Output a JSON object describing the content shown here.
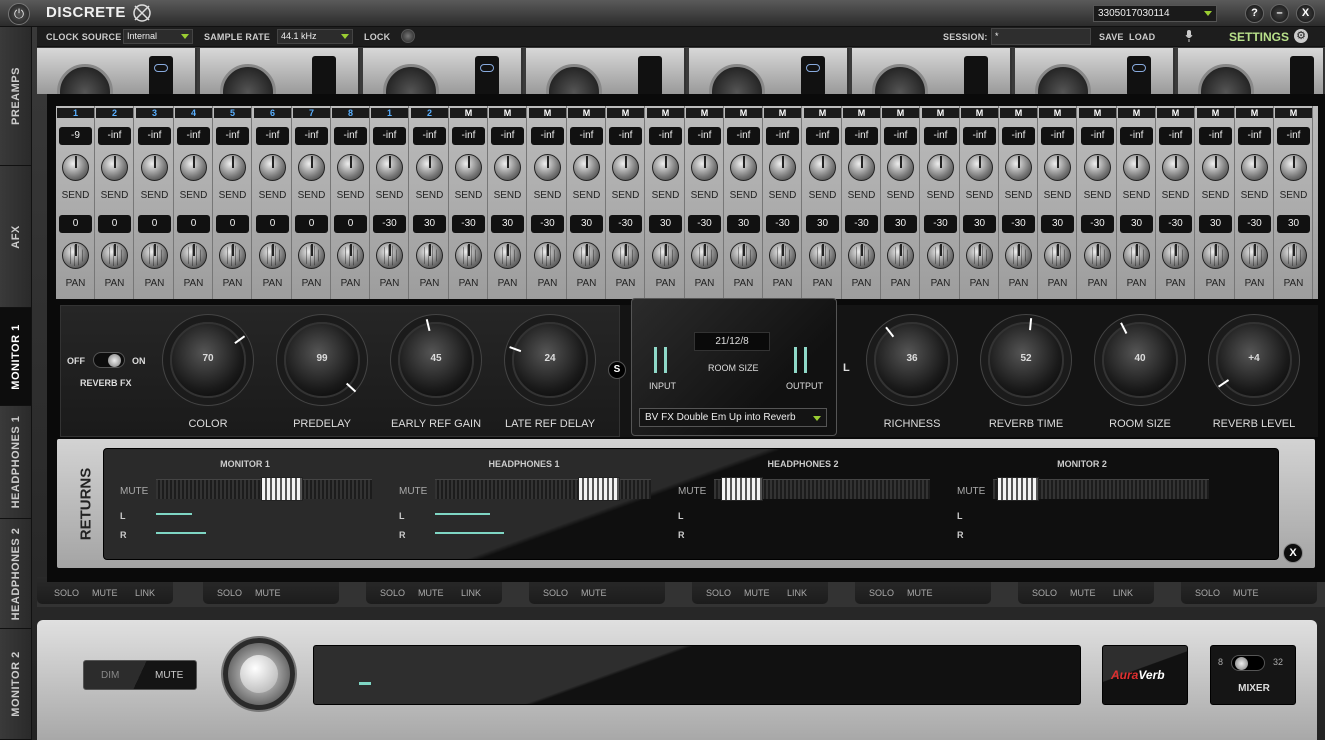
{
  "titlebar": {
    "logo": "DISCRETE",
    "device": "3305017030114",
    "help": "?",
    "minimize": "–",
    "close": "X"
  },
  "toolbar": {
    "clock_source_label": "CLOCK SOURCE",
    "clock_source_value": "Internal",
    "sample_rate_label": "SAMPLE RATE",
    "sample_rate_value": "44.1 kHz",
    "lock_label": "LOCK",
    "session_label": "SESSION:",
    "session_value": "*",
    "save_label": "SAVE",
    "load_label": "LOAD",
    "settings_label": "SETTINGS"
  },
  "side_tabs": [
    "PREAMPS",
    "AFX",
    "MONITOR 1",
    "HEADPHONES 1",
    "HEADPHONES 2",
    "MONITOR 2"
  ],
  "channels": [
    {
      "head": "1",
      "blue": true,
      "send": "-9",
      "pan": "0"
    },
    {
      "head": "2",
      "blue": true,
      "send": "-inf",
      "pan": "0"
    },
    {
      "head": "3",
      "blue": true,
      "send": "-inf",
      "pan": "0"
    },
    {
      "head": "4",
      "blue": true,
      "send": "-inf",
      "pan": "0"
    },
    {
      "head": "5",
      "blue": true,
      "send": "-inf",
      "pan": "0"
    },
    {
      "head": "6",
      "blue": true,
      "send": "-inf",
      "pan": "0"
    },
    {
      "head": "7",
      "blue": true,
      "send": "-inf",
      "pan": "0"
    },
    {
      "head": "8",
      "blue": true,
      "send": "-inf",
      "pan": "0"
    },
    {
      "head": "1",
      "blue": true,
      "send": "-inf",
      "pan": "-30"
    },
    {
      "head": "2",
      "blue": true,
      "send": "-inf",
      "pan": "30"
    },
    {
      "head": "M",
      "blue": false,
      "send": "-inf",
      "pan": "-30"
    },
    {
      "head": "M",
      "blue": false,
      "send": "-inf",
      "pan": "30"
    },
    {
      "head": "M",
      "blue": false,
      "send": "-inf",
      "pan": "-30"
    },
    {
      "head": "M",
      "blue": false,
      "send": "-inf",
      "pan": "30"
    },
    {
      "head": "M",
      "blue": false,
      "send": "-inf",
      "pan": "-30"
    },
    {
      "head": "M",
      "blue": false,
      "send": "-inf",
      "pan": "30"
    },
    {
      "head": "M",
      "blue": false,
      "send": "-inf",
      "pan": "-30"
    },
    {
      "head": "M",
      "blue": false,
      "send": "-inf",
      "pan": "30"
    },
    {
      "head": "M",
      "blue": false,
      "send": "-inf",
      "pan": "-30"
    },
    {
      "head": "M",
      "blue": false,
      "send": "-inf",
      "pan": "30"
    },
    {
      "head": "M",
      "blue": false,
      "send": "-inf",
      "pan": "-30"
    },
    {
      "head": "M",
      "blue": false,
      "send": "-inf",
      "pan": "30"
    },
    {
      "head": "M",
      "blue": false,
      "send": "-inf",
      "pan": "-30"
    },
    {
      "head": "M",
      "blue": false,
      "send": "-inf",
      "pan": "30"
    },
    {
      "head": "M",
      "blue": false,
      "send": "-inf",
      "pan": "-30"
    },
    {
      "head": "M",
      "blue": false,
      "send": "-inf",
      "pan": "30"
    },
    {
      "head": "M",
      "blue": false,
      "send": "-inf",
      "pan": "-30"
    },
    {
      "head": "M",
      "blue": false,
      "send": "-inf",
      "pan": "30"
    },
    {
      "head": "M",
      "blue": false,
      "send": "-inf",
      "pan": "-30"
    },
    {
      "head": "M",
      "blue": false,
      "send": "-inf",
      "pan": "30"
    },
    {
      "head": "M",
      "blue": false,
      "send": "-inf",
      "pan": "-30"
    },
    {
      "head": "M",
      "blue": false,
      "send": "-inf",
      "pan": "30"
    }
  ],
  "send_label": "SEND",
  "pan_label": "PAN",
  "reverb": {
    "off_label": "OFF",
    "on_label": "ON",
    "fx_label": "REVERB FX",
    "s_badge": "S",
    "l_badge": "L",
    "knobs_left": [
      {
        "title": "COLOR",
        "value": "70"
      },
      {
        "title": "PREDELAY",
        "value": "99"
      },
      {
        "title": "EARLY REF GAIN",
        "value": "45"
      },
      {
        "title": "LATE REF DELAY",
        "value": "24"
      }
    ],
    "knobs_right": [
      {
        "title": "RICHNESS",
        "value": "36"
      },
      {
        "title": "REVERB TIME",
        "value": "52"
      },
      {
        "title": "ROOM SIZE",
        "value": "40"
      },
      {
        "title": "REVERB LEVEL",
        "value": "+4"
      }
    ],
    "room_display": "21/12/8",
    "input_label": "INPUT",
    "room_size_label": "ROOM SIZE",
    "output_label": "OUTPUT",
    "preset": "BV FX Double Em Up into Reverb"
  },
  "returns": {
    "title": "RETURNS",
    "mute_label": "MUTE",
    "l_label": "L",
    "r_label": "R",
    "groups": [
      {
        "name": "MONITOR 1",
        "level": 0.61
      },
      {
        "name": "HEADPHONES 1",
        "level": 0.84
      },
      {
        "name": "HEADPHONES 2",
        "level": 0.02
      },
      {
        "name": "MONITOR 2",
        "level": 0.0
      }
    ],
    "close": "X"
  },
  "strip_footer": {
    "solo": "SOLO",
    "mute": "MUTE",
    "link": "LINK"
  },
  "bottom": {
    "dim": "DIM",
    "mute": "MUTE",
    "auraverb_a": "Aura",
    "auraverb_b": "Verb",
    "mixer_8": "8",
    "mixer_32": "32",
    "mixer_label": "MIXER"
  }
}
